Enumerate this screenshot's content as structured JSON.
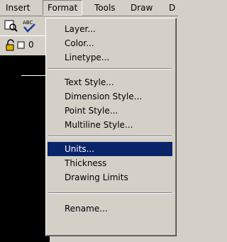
{
  "menubar": {
    "items": [
      "Insert",
      "Format",
      "Tools",
      "Draw",
      "D"
    ],
    "active": "Format"
  },
  "toolbar": {
    "layer_state": "0",
    "icons": [
      "print-preview-icon",
      "spell-check-icon",
      "layer-lock-icon",
      "layer-color-swatch-icon"
    ]
  },
  "format_menu": {
    "groups": [
      [
        "Layer...",
        "Color...",
        "Linetype..."
      ],
      [
        "Text Style...",
        "Dimension Style...",
        "Point Style...",
        "Multiline Style..."
      ],
      [
        "Units...",
        "Thickness",
        "Drawing Limits"
      ],
      [
        "Rename..."
      ]
    ],
    "highlighted": "Units..."
  },
  "colors": {
    "face": "#d4d0c8",
    "highlight": "#0a246a",
    "drawing_bg": "#000000"
  }
}
